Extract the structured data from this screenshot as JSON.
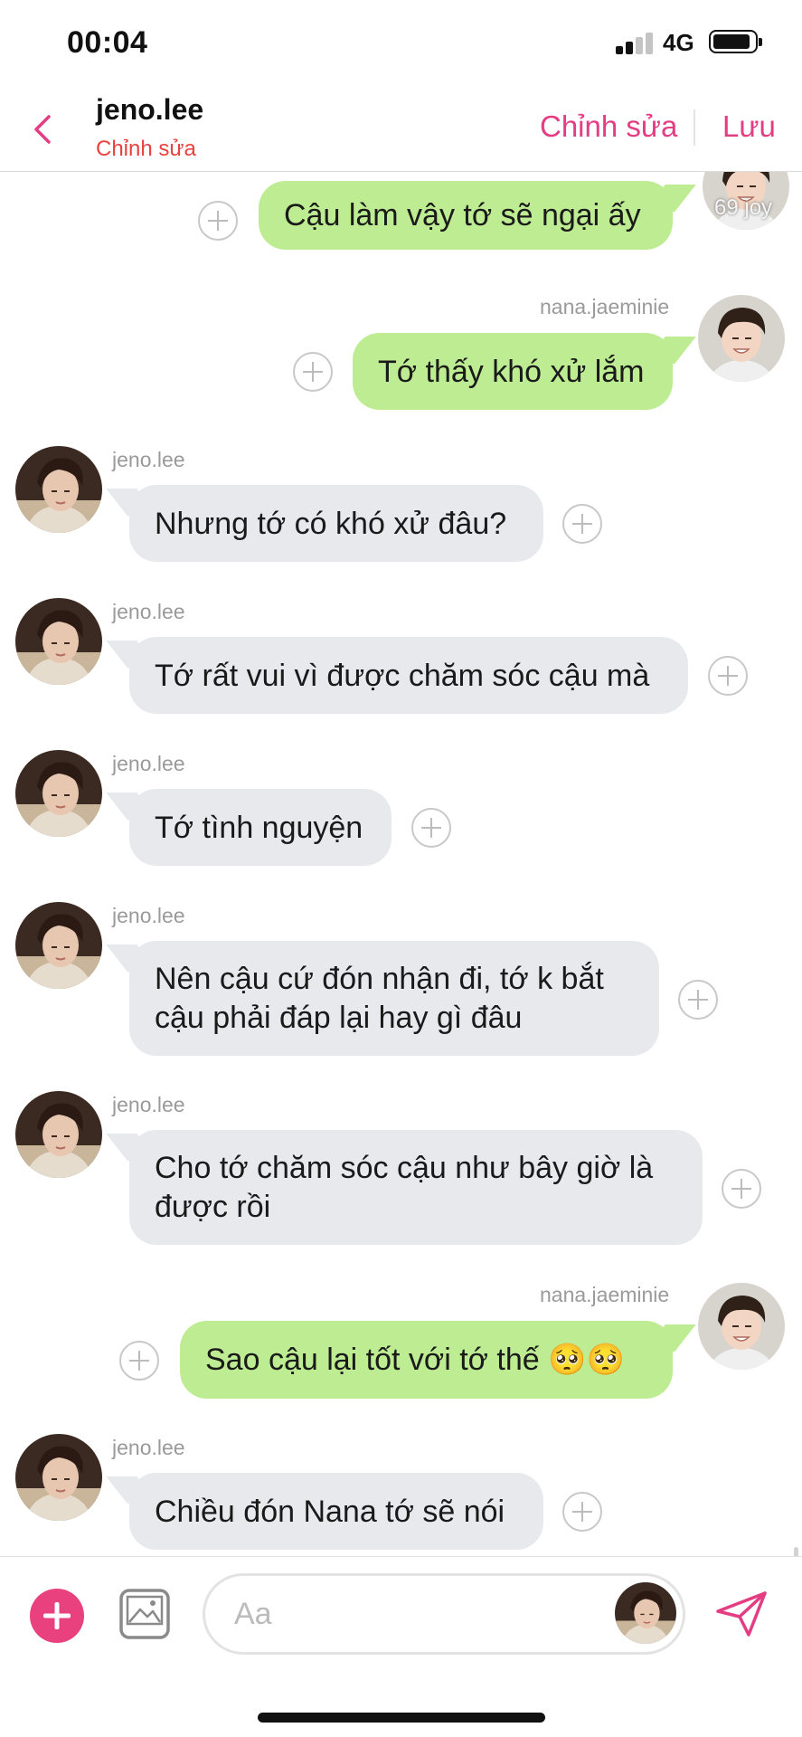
{
  "status_bar": {
    "time": "00:04",
    "network": "4G"
  },
  "header": {
    "name": "jeno.lee",
    "subtitle": "Chỉnh sửa",
    "edit_label": "Chỉnh sửa",
    "save_label": "Lưu"
  },
  "messages": [
    {
      "side": "right",
      "sender": "",
      "text": "Cậu làm vậy tớ sẽ ngại ấy",
      "avatar_caption": "69 joy"
    },
    {
      "side": "right",
      "sender": "nana.jaeminie",
      "text": "Tớ thấy khó xử lắm"
    },
    {
      "side": "left",
      "sender": "jeno.lee",
      "text": "Nhưng tớ có khó xử đâu?"
    },
    {
      "side": "left",
      "sender": "jeno.lee",
      "text": "Tớ rất vui vì được chăm sóc cậu mà"
    },
    {
      "side": "left",
      "sender": "jeno.lee",
      "text": "Tớ tình nguyện"
    },
    {
      "side": "left",
      "sender": "jeno.lee",
      "text": "Nên cậu cứ đón nhận đi, tớ k bắt cậu phải đáp lại hay gì đâu"
    },
    {
      "side": "left",
      "sender": "jeno.lee",
      "text": "Cho tớ chăm sóc cậu như bây giờ là được rồi"
    },
    {
      "side": "right",
      "sender": "nana.jaeminie",
      "text": "Sao cậu lại tốt với tớ thế 🥺🥺"
    },
    {
      "side": "left",
      "sender": "jeno.lee",
      "text": "Chiều đón Nana tớ sẽ nói"
    }
  ],
  "input": {
    "placeholder": "Aa"
  },
  "icons": {
    "back": "chevron-left-icon",
    "add": "plus-circle-icon",
    "image": "image-icon",
    "send": "paper-plane-icon"
  },
  "colors": {
    "accent": "#e33d84",
    "subtitle": "#e9413f",
    "bubble_right": "#bdec92",
    "bubble_left": "#e7e9ec",
    "plus_button": "#e8417e"
  }
}
